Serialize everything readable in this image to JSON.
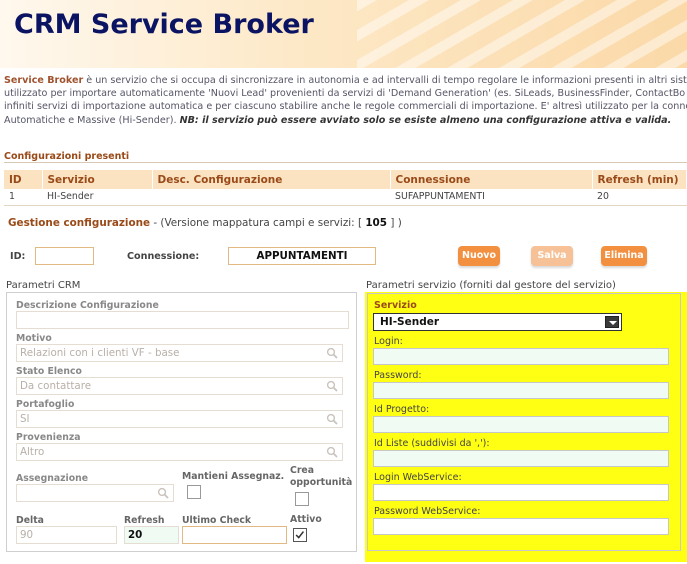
{
  "header": {
    "title": "CRM Service Broker"
  },
  "intro": {
    "brand": "Service Broker",
    "line1": " è un servizio che si occupa di sincronizzare in autonomia e ad intervalli di tempo regolare le informazioni presenti in altri sist",
    "line2": "utilizzato per importare automaticamente 'Nuovi Lead' provenienti da servizi di 'Demand Generation' (es. SiLeads, BusinessFinder, ContactBo",
    "line3": "infiniti servizi di importazione automatica e per ciascuno stabilire anche le regole commerciali di importazione. E' altresì utilizzato per la connessi",
    "line4": "Automatiche e Massive (Hi-Sender). ",
    "note": "NB: il servizio può essere avviato solo se esiste almeno una configurazione attiva e valida."
  },
  "configurazioni": {
    "title": "Configurazioni presenti",
    "columns": [
      "ID",
      "Servizio",
      "Desc. Configurazione",
      "Connessione",
      "Refresh (min)"
    ],
    "rows": [
      {
        "id": "1",
        "servizio": "HI-Sender",
        "desc": "",
        "connessione": "SUFAPPUNTAMENTI",
        "refresh": "20"
      }
    ]
  },
  "gestione": {
    "title": "Gestione configurazione",
    "version_prefix": " - (Versione mappatura campi e servizi: [ ",
    "version": "105",
    "version_suffix": " ] )",
    "id_label": "ID:",
    "id_value": "",
    "conn_label": "Connessione:",
    "conn_value": "APPUNTAMENTI",
    "btn_nuovo": "Nuovo",
    "btn_salva": "Salva",
    "btn_elimina": "Elimina"
  },
  "crm": {
    "title": "Parametri CRM",
    "descrizione_label": "Descrizione Configurazione",
    "descrizione_value": "",
    "motivo_label": "Motivo",
    "motivo_value": "Relazioni con i clienti VF - base",
    "stato_label": "Stato Elenco",
    "stato_value": "Da contattare",
    "portafoglio_label": "Portafoglio",
    "portafoglio_value": "SI",
    "provenienza_label": "Provenienza",
    "provenienza_value": "Altro",
    "assegnazione_label": "Assegnazione",
    "assegnazione_value": "",
    "mantieni_label": "Mantieni Assegnaz.",
    "mantieni_checked": false,
    "crea_label_1": "Crea",
    "crea_label_2": "opportunità",
    "crea_checked": false,
    "delta_label": "Delta",
    "delta_value": "90",
    "refresh_label": "Refresh",
    "refresh_value": "20",
    "ultimo_label": "Ultimo Check",
    "ultimo_value": "",
    "attivo_label": "Attivo",
    "attivo_checked": true
  },
  "servizio": {
    "title": "Parametri servizio (forniti dal gestore del servizio)",
    "servizio_label": "Servizio",
    "servizio_value": "HI-Sender",
    "login_label": "Login:",
    "password_label": "Password:",
    "progetto_label": "Id Progetto:",
    "liste_label": "Id Liste (suddivisi da ','):",
    "login_ws_label": "Login WebService:",
    "password_ws_label": "Password WebService:"
  },
  "colors": {
    "brand_navy": "#0b1463",
    "accent_orange": "#f29040",
    "highlight_yellow": "#ffff14",
    "table_header_bg": "#fbe3c2"
  }
}
